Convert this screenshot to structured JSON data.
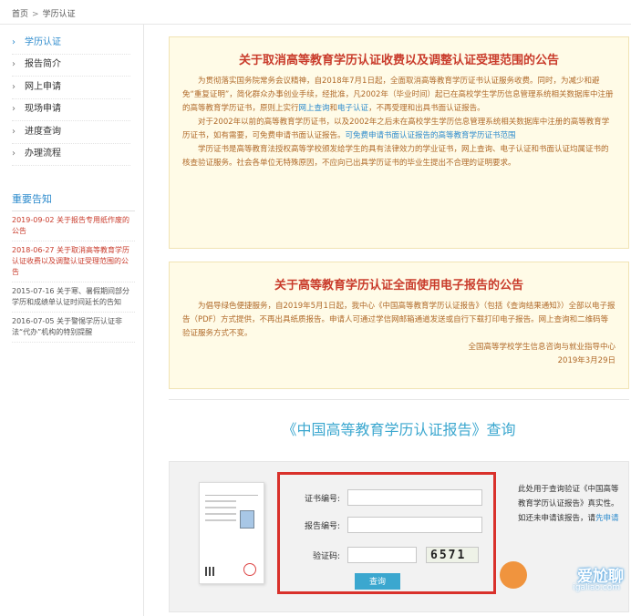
{
  "breadcrumb": {
    "home": "首页",
    "sep": ">",
    "current": "学历认证"
  },
  "sidebar": {
    "items": [
      {
        "label": "学历认证"
      },
      {
        "label": "报告简介"
      },
      {
        "label": "网上申请"
      },
      {
        "label": "现场申请"
      },
      {
        "label": "进度查询"
      },
      {
        "label": "办理流程"
      }
    ],
    "notice_heading": "重要告知",
    "notices": [
      {
        "text": "2019-09-02 关于报告专用纸作废的公告"
      },
      {
        "text": "2018-06-27 关于取消高等教育学历认证收费以及调整认证受理范围的公告"
      },
      {
        "text": "2015-07-16 关于寒、暑假期间部分学历和成绩单认证时间延长的告知"
      },
      {
        "text": "2016-07-05 关于警惕学历认证非法“代办”机构的特别提醒"
      }
    ]
  },
  "announcement1": {
    "title": "关于取消高等教育学历认证收费以及调整认证受理范围的公告",
    "p1_a": "为贯彻落实国务院常务会议精神，自2018年7月1日起，全面取消高等教育学历证书认证服务收费。同时，为减少和避免“重复证明”，简化群众办事创业手续，经批准，凡2002年（毕业时间）起已在高校学生学历信息管理系统相关数据库中注册的高等教育学历证书，原则上实行",
    "p1_link1": "网上查询",
    "p1_and": "和",
    "p1_link2": "电子认证",
    "p1_b": "，不再受理和出具书面认证报告。",
    "p2_a": "对于2002年以前的高等教育学历证书，以及2002年之后未在高校学生学历信息管理系统相关数据库中注册的高等教育学历证书，如有需要，可免费申请书面认证报告。",
    "p2_link": "可免费申请书面认证报告的高等教育学历证书范围",
    "p3": "学历证书是高等教育法授权高等学校颁发给学生的具有法律效力的学业证书，网上查询、电子认证和书面认证均属证书的核查验证服务。社会各单位无特殊原因，不应向已出具学历证书的毕业生提出不合理的证明要求。"
  },
  "announcement2": {
    "title": "关于高等教育学历认证全面使用电子报告的公告",
    "p1": "为倡导绿色便捷服务，自2019年5月1日起，我中心《中国高等教育学历认证报告》（包括《查询结果通知》）全部以电子报告（PDF）方式提供，不再出具纸质报告。申请人可通过学信网邮箱通道发送或自行下载打印电子报告。网上查询和二维码等验证服务方式不变。",
    "signer": "全国高等学校学生信息咨询与就业指导中心",
    "date": "2019年3月29日"
  },
  "query": {
    "title": "《中国高等教育学历认证报告》查询",
    "cert_label": "证书编号:",
    "cert_value": "",
    "report_label": "报告编号:",
    "report_value": "",
    "captcha_label": "验证码:",
    "captcha_value": "",
    "captcha_text": "6571",
    "button": "查询",
    "help_a": "此处用于查询验证《中国高等教育学历认证报告》真实性。如还未申请该报告，请",
    "help_link": "先申请"
  },
  "watermark": {
    "text": "爱尬聊",
    "url": "igaliao.com"
  },
  "colors": {
    "accent": "#3ba7cf",
    "alert": "#c93b2b",
    "highlight_border": "#d9312b"
  }
}
